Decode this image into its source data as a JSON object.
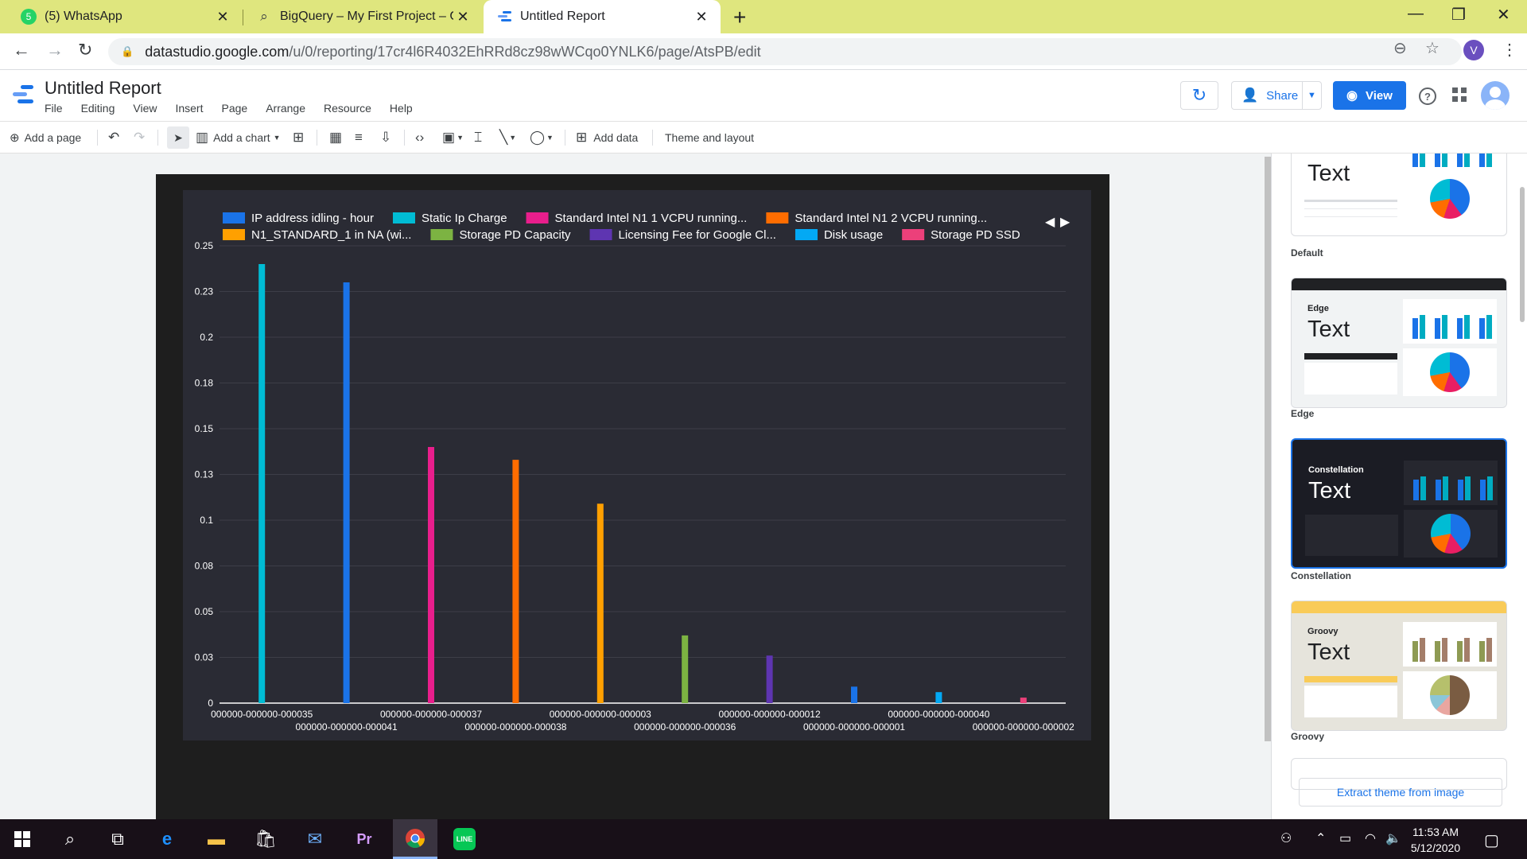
{
  "browser": {
    "tabs": [
      {
        "title": "(5) WhatsApp",
        "icon": "whatsapp-icon",
        "badge": "5"
      },
      {
        "title": "BigQuery – My First Project – Go",
        "icon": "bigquery-icon"
      },
      {
        "title": "Untitled Report",
        "icon": "datastudio-icon",
        "active": true
      }
    ],
    "url_host": "datastudio.google.com",
    "url_path": "/u/0/reporting/17cr4l6R4032EhRRd8cz98wWCqo0YNLK6/page/AtsPB/edit",
    "profile_initial": "V"
  },
  "app": {
    "title": "Untitled Report",
    "menu": [
      "File",
      "Editing",
      "View",
      "Insert",
      "Page",
      "Arrange",
      "Resource",
      "Help"
    ],
    "share_label": "Share",
    "view_label": "View"
  },
  "toolbar": {
    "add_page": "Add a page",
    "add_chart": "Add a chart",
    "add_data": "Add data",
    "theme_layout": "Theme and layout"
  },
  "chart_data": {
    "type": "bar",
    "ylim": [
      0,
      0.25
    ],
    "yticks": [
      "0",
      "0.03",
      "0.05",
      "0.08",
      "0.1",
      "0.13",
      "0.15",
      "0.18",
      "0.2",
      "0.23",
      "0.25"
    ],
    "categories": [
      "000000-000000-000035",
      "000000-000000-000041",
      "000000-000000-000037",
      "000000-000000-000038",
      "000000-000000-000003",
      "000000-000000-000036",
      "000000-000000-000012",
      "000000-000000-000001",
      "000000-000000-000040",
      "000000-000000-000002"
    ],
    "legend_row1": [
      "IP address idling - hour",
      "Static Ip Charge",
      "Standard Intel N1 1 VCPU running...",
      "Standard Intel N1 2 VCPU running..."
    ],
    "legend_row2": [
      "N1_STANDARD_1 in NA (wi...",
      "Storage PD Capacity",
      "Licensing Fee for Google Cl...",
      "Disk usage",
      "Storage PD SSD"
    ],
    "legend_colors_row1": [
      "#1a73e8",
      "#00bcd4",
      "#e91e8c",
      "#ff6d00"
    ],
    "legend_colors_row2": [
      "#ffa000",
      "#7cb342",
      "#5e35b1",
      "#03a9f4",
      "#ec407a"
    ],
    "legend_placement": "top",
    "grid": true,
    "bars": [
      {
        "category_index": 0,
        "series": "Static Ip Charge",
        "color": "#00bcd4",
        "value": 0.24
      },
      {
        "category_index": 1,
        "series": "IP address idling - hour",
        "color": "#1a73e8",
        "value": 0.23
      },
      {
        "category_index": 2,
        "series": "Standard Intel N1 1 VCPU running...",
        "color": "#e91e8c",
        "value": 0.14
      },
      {
        "category_index": 3,
        "series": "Standard Intel N1 2 VCPU running...",
        "color": "#ff6d00",
        "value": 0.133
      },
      {
        "category_index": 4,
        "series": "N1_STANDARD_1 in NA (wi...",
        "color": "#ffa000",
        "value": 0.109
      },
      {
        "category_index": 5,
        "series": "Storage PD Capacity",
        "color": "#7cb342",
        "value": 0.037
      },
      {
        "category_index": 6,
        "series": "Licensing Fee for Google Cl...",
        "color": "#5e35b1",
        "value": 0.026
      },
      {
        "category_index": 7,
        "series": "IP address idling - hour",
        "color": "#1a73e8",
        "value": 0.009
      },
      {
        "category_index": 8,
        "series": "Disk usage",
        "color": "#03a9f4",
        "value": 0.006
      },
      {
        "category_index": 9,
        "series": "Storage PD SSD",
        "color": "#ec407a",
        "value": 0.003
      }
    ]
  },
  "themes": [
    {
      "label": "Default",
      "sample_text": "Text",
      "name": ""
    },
    {
      "label": "Edge",
      "sample_text": "Text",
      "name": "Edge"
    },
    {
      "label": "Constellation",
      "sample_text": "Text",
      "name": "Constellation"
    },
    {
      "label": "Groovy",
      "sample_text": "Text",
      "name": "Groovy"
    }
  ],
  "extract_label": "Extract theme from image",
  "taskbar": {
    "time": "11:53 AM",
    "date": "5/12/2020"
  }
}
